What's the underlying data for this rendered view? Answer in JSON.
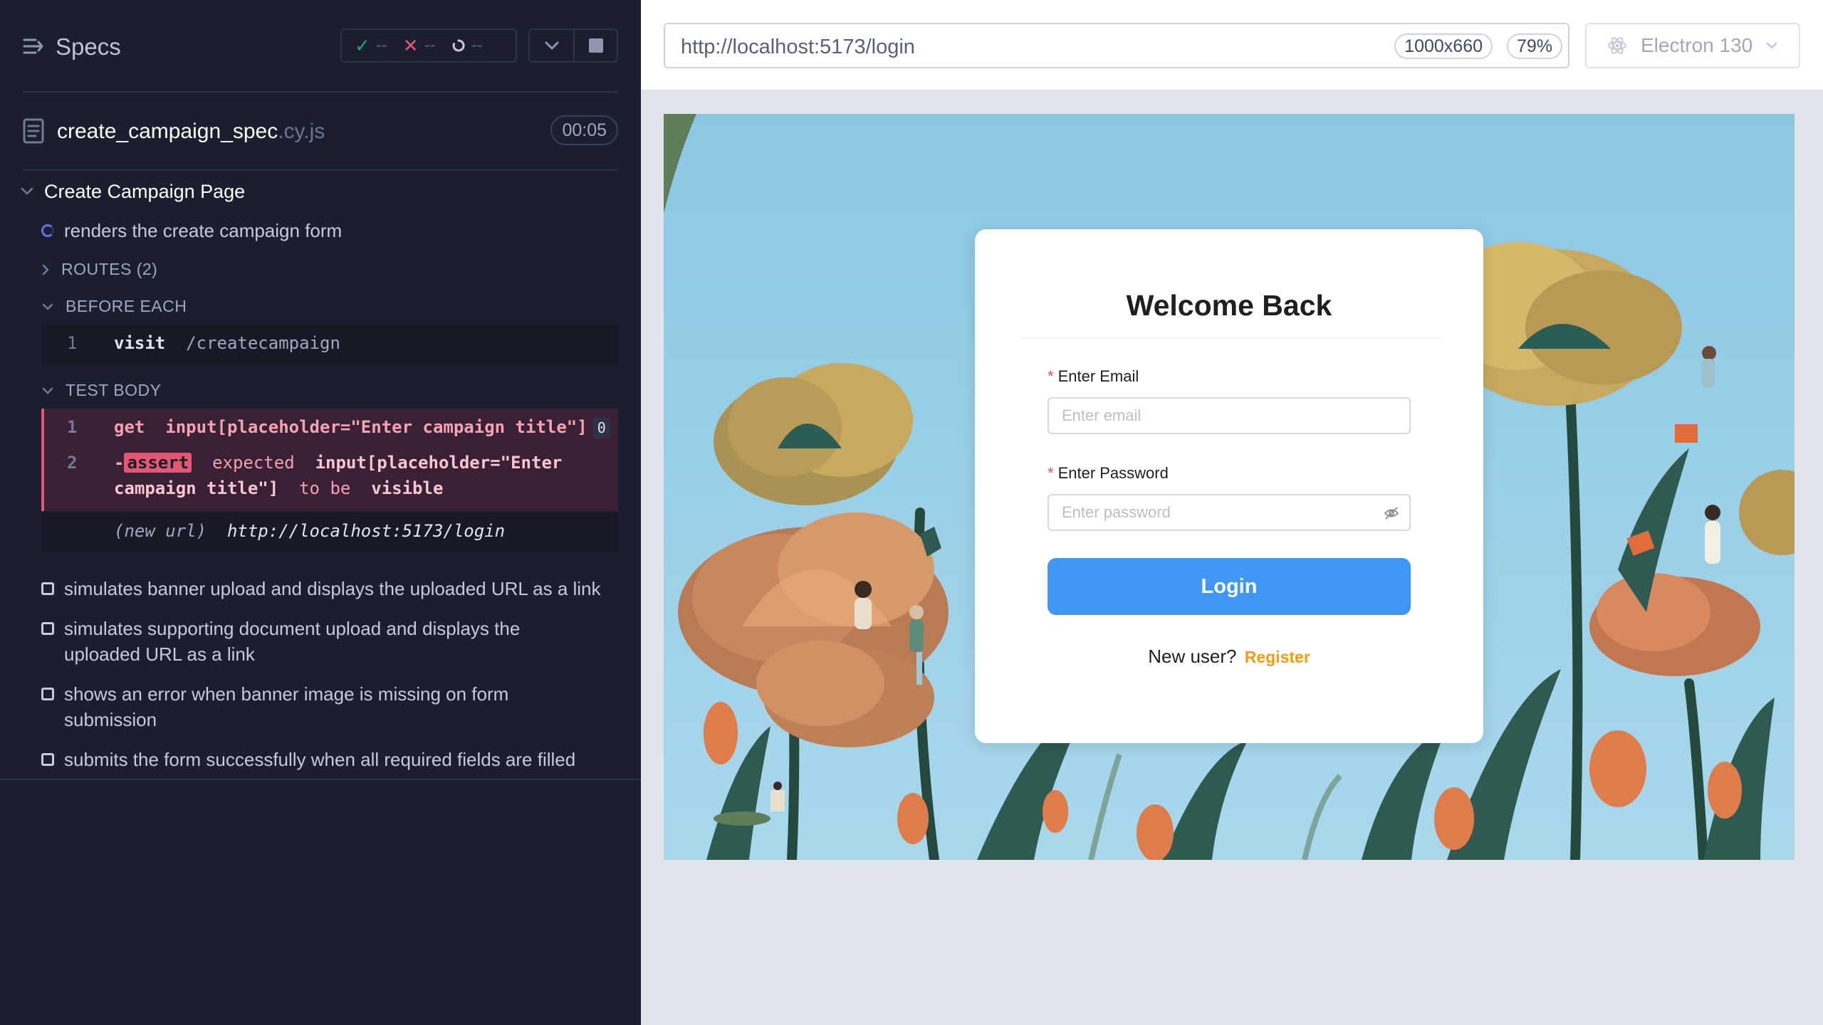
{
  "reporter": {
    "title": "Specs",
    "stats": {
      "passed": "--",
      "failed": "--",
      "pending": "--"
    },
    "spec": {
      "name": "create_campaign_spec",
      "ext": ".cy.js",
      "duration": "00:05"
    },
    "suite": {
      "title": "Create Campaign Page",
      "active_test": "renders the create campaign form",
      "routes_label": "ROUTES (2)",
      "before_each_label": "BEFORE EACH",
      "before_each_cmd": {
        "num": "1",
        "name": "visit",
        "arg": "/createcampaign"
      },
      "test_body_label": "TEST BODY",
      "body_cmd1": {
        "num": "1",
        "name": "get",
        "arg": "input[placeholder=\"Enter campaign title\"]",
        "count": "0"
      },
      "body_cmd2": {
        "num": "2",
        "prefix": "-",
        "name": "assert",
        "text1": "expected",
        "arg1": "input[placeholder=\"Enter",
        "arg2": "campaign title\"]",
        "text2": "to be",
        "text3": "visible"
      },
      "new_url": {
        "label": "(new url)",
        "url": "http://localhost:5173/login"
      },
      "tests": [
        "simulates banner upload and displays the uploaded URL as a link",
        "simulates supporting document upload and displays the uploaded URL as a link",
        "shows an error when banner image is missing on form submission",
        "submits the form successfully when all required fields are filled"
      ]
    }
  },
  "topbar": {
    "url": "http://localhost:5173/login",
    "viewport": "1000x660",
    "scale": "79%",
    "browser": "Electron 130"
  },
  "login": {
    "title": "Welcome Back",
    "email_label": "Enter Email",
    "email_placeholder": "Enter email",
    "password_label": "Enter Password",
    "password_placeholder": "Enter password",
    "button": "Login",
    "new_user": "New user?",
    "register": "Register"
  },
  "colors": {
    "reporter_bg": "#1b1e2e",
    "fail": "#e45770",
    "pass": "#1fa971",
    "primary_button": "#4096f4",
    "register_link": "#f39c12",
    "sky": "#8fcbe6"
  }
}
